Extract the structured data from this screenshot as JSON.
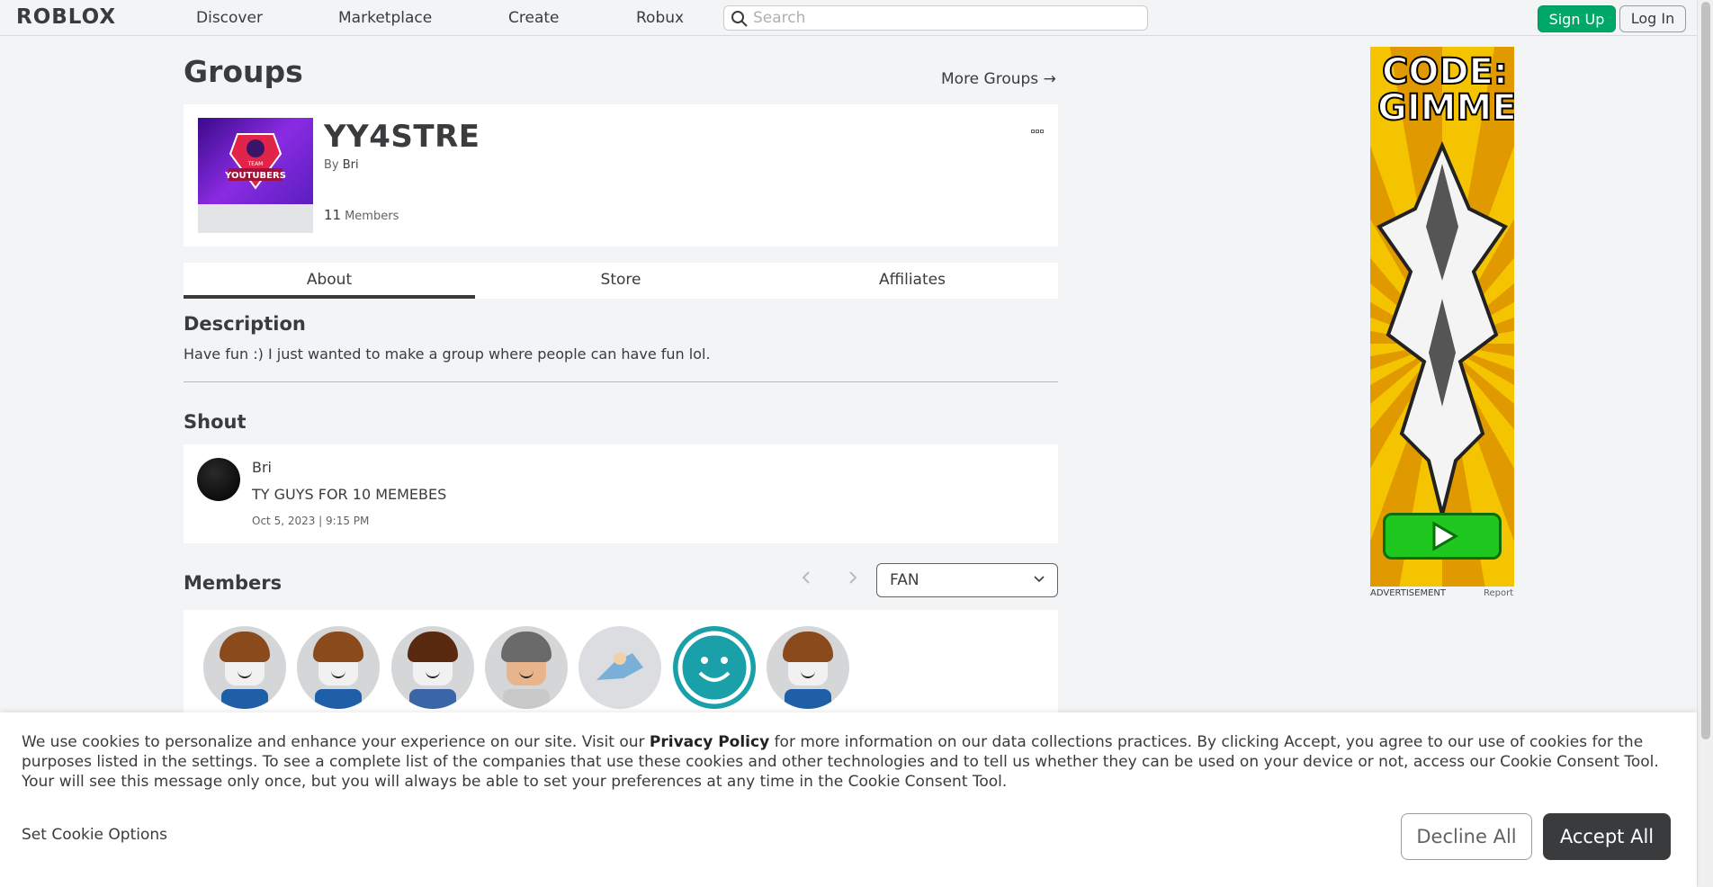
{
  "nav": {
    "logo": "ROBLOX",
    "items": [
      "Discover",
      "Marketplace",
      "Create",
      "Robux"
    ],
    "search_placeholder": "Search",
    "signup": "Sign Up",
    "login": "Log In"
  },
  "page": {
    "title": "Groups",
    "more_groups": "More Groups →"
  },
  "group": {
    "name": "YY4STRE",
    "by_label": "By",
    "owner": "Bri",
    "member_count": "11",
    "members_label": "Members",
    "emblem_text": "TEAM YOUTUBERS"
  },
  "tabs": [
    "About",
    "Store",
    "Affiliates"
  ],
  "description": {
    "heading": "Description",
    "text": "Have fun :) I just wanted to make a group where people can have fun lol."
  },
  "shout": {
    "heading": "Shout",
    "user": "Bri",
    "body": "TY GUYS FOR 10 MEMEBES",
    "time": "Oct 5, 2023 | 9:15 PM"
  },
  "members": {
    "heading": "Members",
    "role": "FAN",
    "avatars": [
      "member-1",
      "member-2",
      "member-3",
      "member-4",
      "member-5",
      "member-6",
      "member-7"
    ]
  },
  "ad": {
    "headline": "CODE: GIMME",
    "label": "ADVERTISEMENT",
    "report": "Report"
  },
  "cookie": {
    "text_before": "We use cookies to personalize and enhance your experience on our site. Visit our ",
    "link": "Privacy Policy",
    "text_after": " for more information on our data collections practices. By clicking Accept, you agree to our use of cookies for the purposes listed in the settings. To see a complete list of the companies that use these cookies and other technologies and to tell us whether they can be used on your device or not, access our Cookie Consent Tool. Your will see this message only once, but you will always be able to set your preferences at any time in the Cookie Consent Tool.",
    "options": "Set Cookie Options",
    "decline": "Decline All",
    "accept": "Accept All"
  },
  "colors": {
    "brand_green": "#00a868",
    "text": "#393b3d",
    "page_bg": "#f2f4f5"
  }
}
